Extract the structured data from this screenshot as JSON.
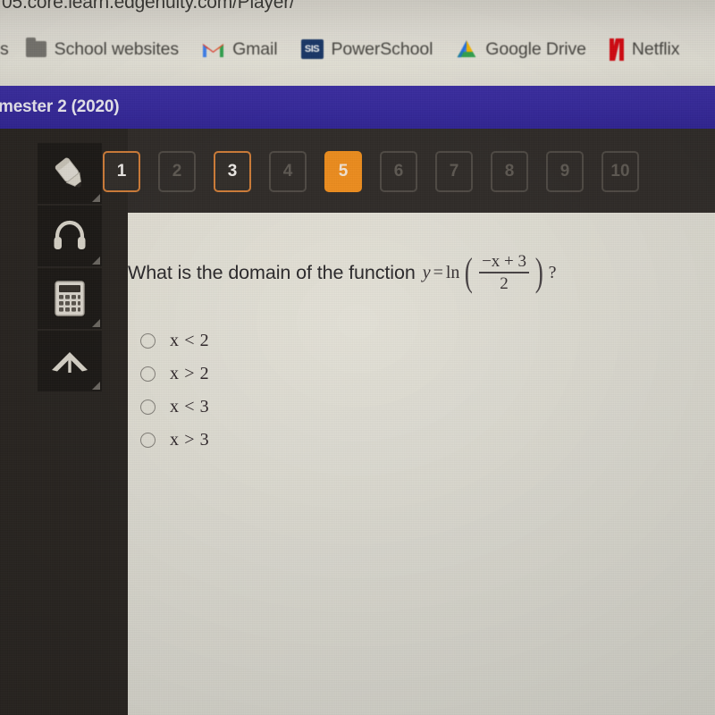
{
  "browser": {
    "url": "05.core.learn.edgenuity.com/Player/",
    "bookmarks": [
      {
        "label": "s",
        "icon": "bookmark-partial"
      },
      {
        "label": "School websites",
        "icon": "folder-icon"
      },
      {
        "label": "Gmail",
        "icon": "gmail-icon"
      },
      {
        "label": "PowerSchool",
        "icon": "sis-icon",
        "badge": "SIS"
      },
      {
        "label": "Google Drive",
        "icon": "google-drive-icon"
      },
      {
        "label": "Netflix",
        "icon": "netflix-icon"
      }
    ]
  },
  "banner": {
    "course_title": "mester 2 (2020)",
    "color": "#3d2fa6"
  },
  "sidebar": {
    "tools": [
      {
        "name": "pencil-tool",
        "label": "Highlighter"
      },
      {
        "name": "audio-tool",
        "label": "Read Aloud"
      },
      {
        "name": "calculator-tool",
        "label": "Calculator"
      },
      {
        "name": "glossary-tool",
        "label": "Glossary"
      }
    ]
  },
  "question_nav": {
    "accent_done": "#d4803a",
    "accent_current": "#f2901f",
    "tabs": [
      {
        "number": "1",
        "state": "done"
      },
      {
        "number": "2",
        "state": "todo"
      },
      {
        "number": "3",
        "state": "done"
      },
      {
        "number": "4",
        "state": "todo"
      },
      {
        "number": "5",
        "state": "current"
      },
      {
        "number": "6",
        "state": "todo"
      },
      {
        "number": "7",
        "state": "todo"
      },
      {
        "number": "8",
        "state": "todo"
      },
      {
        "number": "9",
        "state": "todo"
      },
      {
        "number": "10",
        "state": "todo"
      }
    ]
  },
  "question": {
    "prompt": "What is the domain of the function",
    "math": {
      "lhs": "y",
      "equals": "=",
      "fn": "ln",
      "numerator": "−x + 3",
      "denominator": "2"
    },
    "terminator": "?",
    "options": [
      {
        "id": "a",
        "text": "x < 2",
        "var": "x",
        "rel": "< 2",
        "selected": false
      },
      {
        "id": "b",
        "text": "x > 2",
        "var": "x",
        "rel": "> 2",
        "selected": false
      },
      {
        "id": "c",
        "text": "x < 3",
        "var": "x",
        "rel": "< 3",
        "selected": false
      },
      {
        "id": "d",
        "text": "x > 3",
        "var": "x",
        "rel": "> 3",
        "selected": false
      }
    ]
  }
}
